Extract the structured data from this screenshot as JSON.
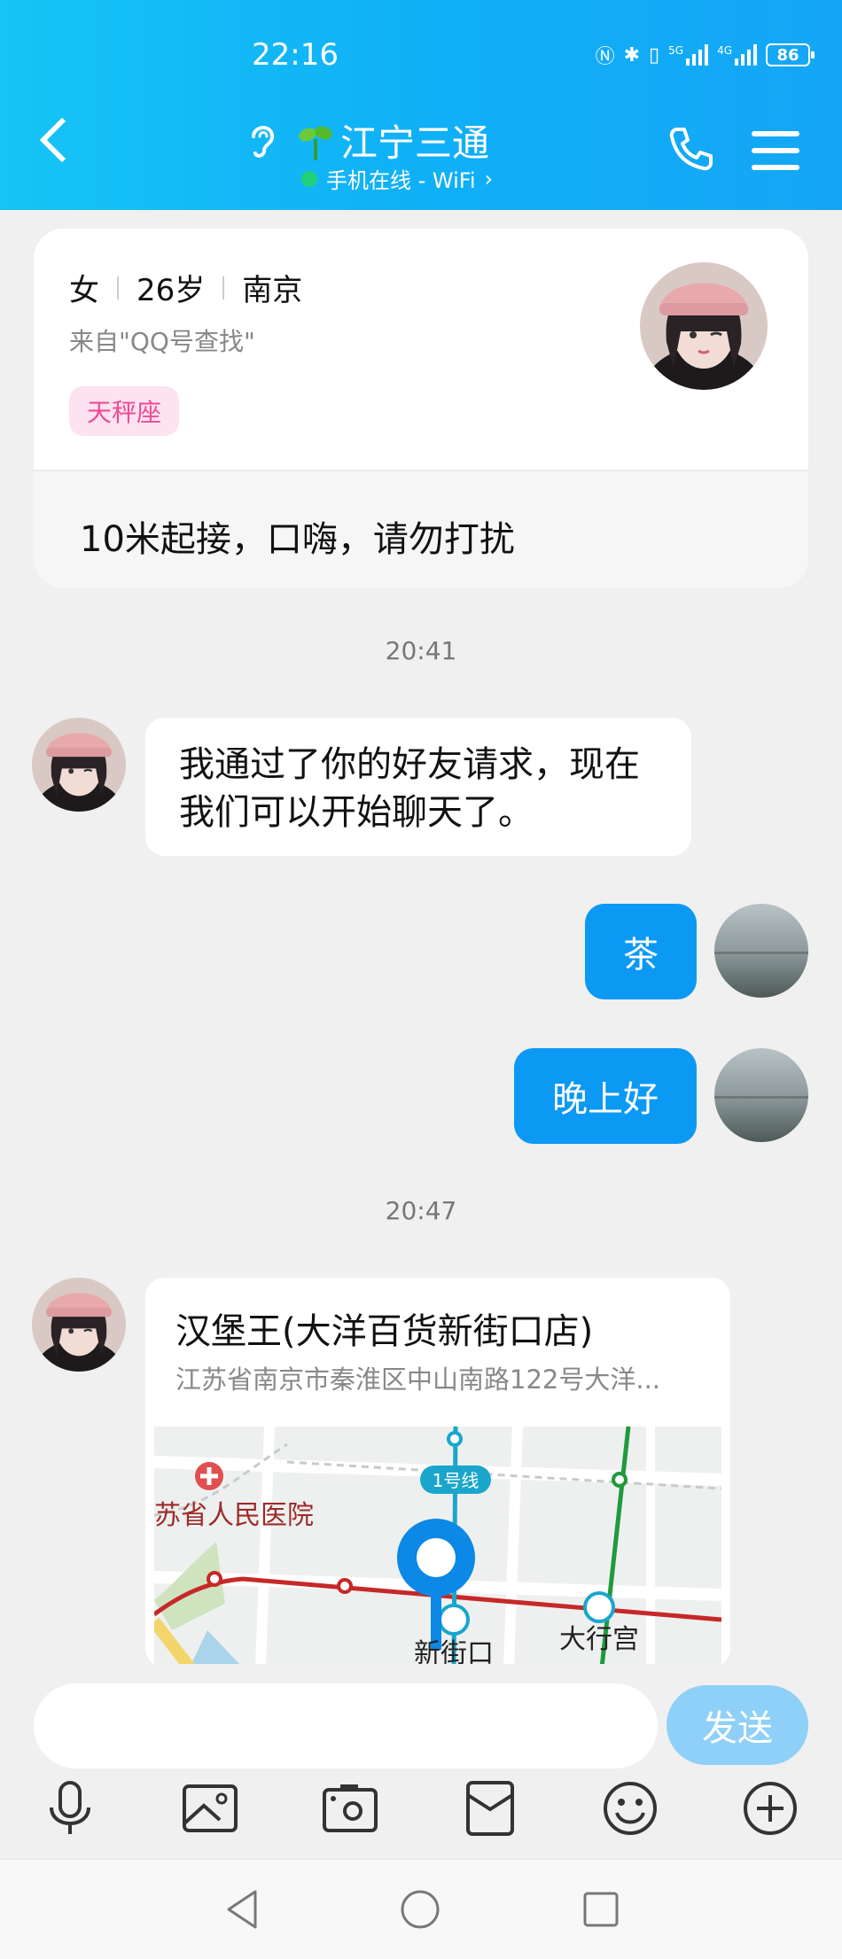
{
  "status_bar": {
    "time": "22:16",
    "battery": "86",
    "net1": "5G",
    "net2": "4G"
  },
  "header": {
    "title": "江宁三通",
    "status": "手机在线 - WiFi",
    "status_arrow": "›"
  },
  "profile": {
    "gender": "女",
    "age": "26岁",
    "city": "南京",
    "source": "来自\"QQ号查找\"",
    "zodiac_tag": "天秤座",
    "signature": "10米起接，口嗨，请勿打扰"
  },
  "chat": {
    "timestamp_1": "20:41",
    "msg_in_1": "我通过了你的好友请求，现在我们可以开始聊天了。",
    "msg_out_1": "茶",
    "msg_out_2": "晚上好",
    "timestamp_2": "20:47",
    "location": {
      "name": "汉堡王(大洋百货新街口店)",
      "address": "江苏省南京市秦淮区中山南路122号大洋...",
      "map_labels": {
        "hospital": "苏省人民医院",
        "line": "1号线",
        "station_1": "新街口",
        "station_2": "大行宫"
      }
    }
  },
  "input": {
    "placeholder": "",
    "send_label": "发送"
  },
  "toolbar": [
    "microphone-icon",
    "image-icon",
    "camera-icon",
    "red-envelope-icon",
    "emoji-icon",
    "plus-icon"
  ],
  "colors": {
    "header": "#10b0f7",
    "bubble_out": "#0c99f4",
    "send": "#8fd0f8",
    "tag_bg": "#fde3ef",
    "tag_text": "#ef4a97"
  }
}
